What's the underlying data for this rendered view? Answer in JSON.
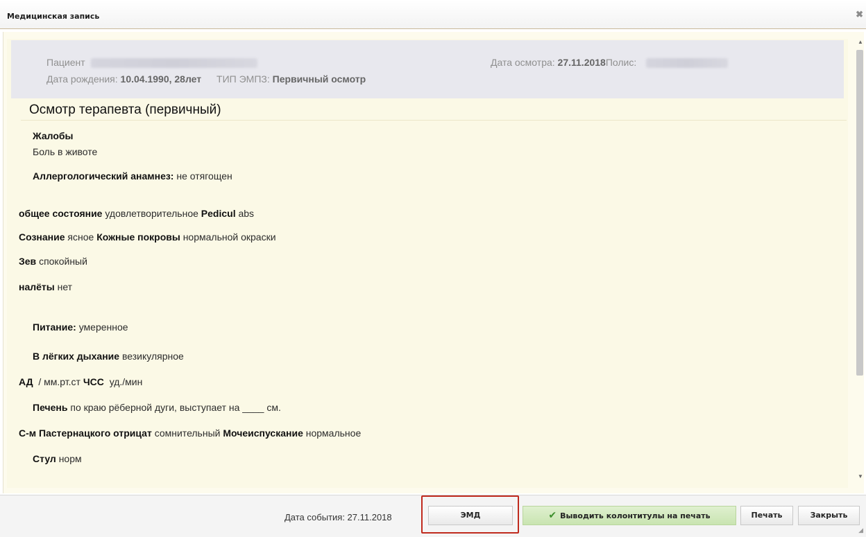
{
  "window": {
    "title": "Медицинская запись",
    "close_glyph": "✖"
  },
  "patient": {
    "label": "Пациент",
    "dob_label": "Дата рождения:",
    "dob_value": "10.04.1990, 28лет",
    "type_label": "ТИП ЭМПЗ:",
    "type_value": "Первичный осмотр",
    "exam_date_label": "Дата осмотра:",
    "exam_date_value": "27.11.2018",
    "policy_label": "Полис:"
  },
  "form": {
    "title": "Осмотр терапевта (первичный)",
    "complaints_label": "Жалобы",
    "complaints_value": "Боль в животе",
    "allergy_label": "Аллергологический анамнез:",
    "allergy_value": "не отягощен",
    "state_label": "общее состояние",
    "state_value": "удовлетворительное",
    "pedicul_label": "Pedicul",
    "pedicul_value": "abs",
    "consciousness_label": "Сознание",
    "consciousness_value": "ясное",
    "skin_label": "Кожные покровы",
    "skin_value": "нормальной окраски",
    "throat_label": "Зев",
    "throat_value": "спокойный",
    "plaque_label": "налёты",
    "plaque_value": "нет",
    "nutrition_label": "Питание:",
    "nutrition_value": "умеренное",
    "lungs_label": "В лёгких дыхание",
    "lungs_value": "везикулярное",
    "bp_label": "АД",
    "bp_value": "/ мм.рт.ст",
    "hr_label": "ЧСС",
    "hr_value": "уд./мин",
    "liver_label": "Печень",
    "liver_value": "по краю рёберной дуги, выступает на ____ см.",
    "pasternatsky_label": "С-м Пастернацкого отрицат",
    "pasternatsky_value": "сомнительный",
    "urination_label": "Мочеиспускание",
    "urination_value": "нормальное",
    "stool_label": "Стул",
    "stool_value": "норм"
  },
  "footer": {
    "event_date": "Дата события: 27.11.2018",
    "emd_button": "ЭМД",
    "headers_button": "Выводить колонтитулы на печать",
    "print_button": "Печать",
    "close_button": "Закрыть"
  },
  "colors": {
    "highlight": "#c02a1d",
    "headers_button_bg": "#c9e4b1",
    "content_bg": "#fbf9e6"
  }
}
